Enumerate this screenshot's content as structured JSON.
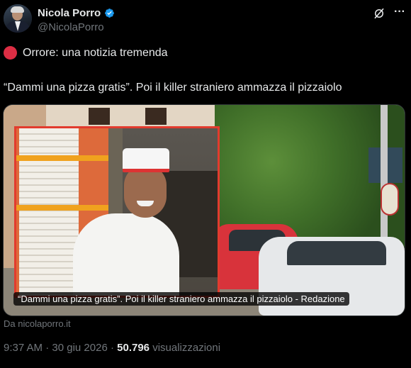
{
  "author": {
    "name": "Nicola Porro",
    "handle": "@NicolaPorro",
    "verified": true
  },
  "tweet": {
    "line1": "Orrore: una notizia tremenda",
    "line1_icon": "red-circle-emoji",
    "line2": "“Dammi una pizza gratis”. Poi il killer straniero ammazza il pizzaiolo"
  },
  "card": {
    "caption": "“Dammi una pizza gratis”. Poi il killer straniero ammazza il pizzaiolo - Redazione",
    "source": "Da nicolaporro.it"
  },
  "meta": {
    "time": "9:37 AM",
    "separator": " · ",
    "date": "30 giu 2026",
    "views_count": "50.796",
    "views_label": "visualizzazioni"
  },
  "icons": {
    "grok": "grok-icon",
    "more": "more-icon",
    "verified": "verified-badge-icon"
  },
  "colors": {
    "background": "#000000",
    "text": "#e7e9ea",
    "muted": "#71767b",
    "verified_blue": "#1d9bf0",
    "emoji_red": "#dd2e44",
    "inset_border": "#e23b2e"
  }
}
